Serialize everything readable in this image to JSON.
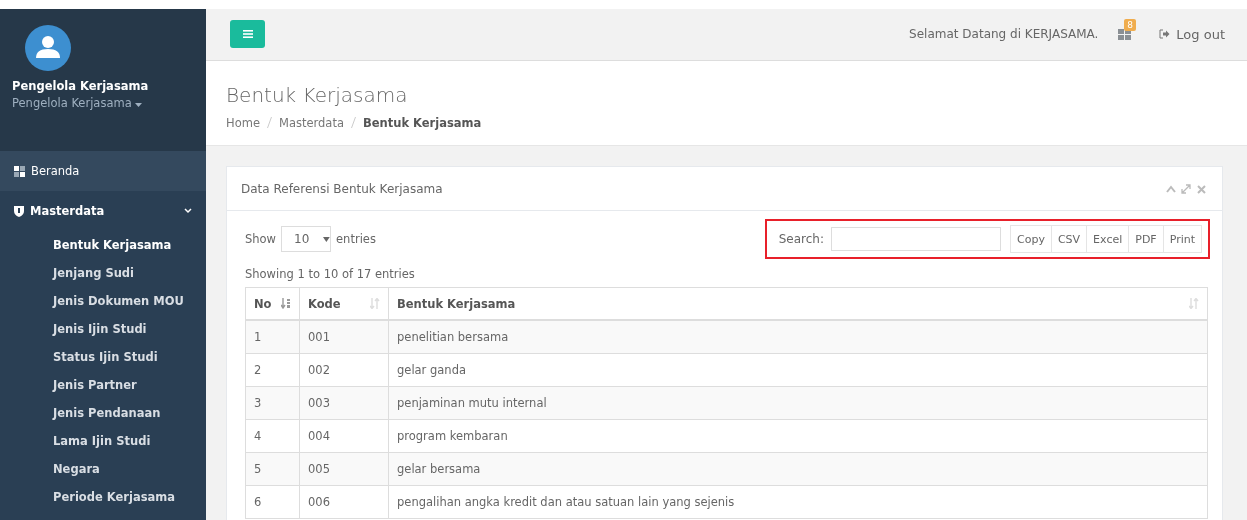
{
  "user": {
    "name": "Pengelola Kerjasama",
    "role": "Pengelola Kerjasama"
  },
  "sidebar": {
    "items": [
      {
        "label": "Beranda",
        "kind": "link"
      },
      {
        "label": "Masterdata",
        "kind": "group",
        "expanded": true,
        "children": [
          {
            "label": "Bentuk Kerjasama",
            "selected": true
          },
          {
            "label": "Jenjang Sudi",
            "selected": false
          },
          {
            "label": "Jenis Dokumen MOU",
            "selected": false
          },
          {
            "label": "Jenis Ijin Studi",
            "selected": false
          },
          {
            "label": "Status Ijin Studi",
            "selected": false
          },
          {
            "label": "Jenis Partner",
            "selected": false
          },
          {
            "label": "Jenis Pendanaan",
            "selected": false
          },
          {
            "label": "Lama Ijin Studi",
            "selected": false
          },
          {
            "label": "Negara",
            "selected": false
          },
          {
            "label": "Periode Kerjasama",
            "selected": false
          }
        ]
      }
    ]
  },
  "topbar": {
    "welcome": "Selamat Datang di KERJASAMA.",
    "badge": "8",
    "logout": "Log out"
  },
  "page": {
    "title": "Bentuk Kerjasama",
    "breadcrumb": [
      {
        "label": "Home",
        "current": false
      },
      {
        "label": "Masterdata",
        "current": false
      },
      {
        "label": "Bentuk Kerjasama",
        "current": true
      }
    ]
  },
  "panel": {
    "title": "Data Referensi Bentuk Kerjasama",
    "length": {
      "before": "Show",
      "value": "10",
      "after": "entries"
    },
    "search": {
      "label": "Search:",
      "highlighted": true
    },
    "buttons": [
      "Copy",
      "CSV",
      "Excel",
      "PDF",
      "Print"
    ],
    "info": "Showing 1 to 10 of 17 entries",
    "table": {
      "columns": [
        {
          "label": "No"
        },
        {
          "label": "Kode"
        },
        {
          "label": "Bentuk Kerjasama"
        }
      ],
      "rows": [
        [
          "1",
          "001",
          "penelitian bersama"
        ],
        [
          "2",
          "002",
          "gelar ganda"
        ],
        [
          "3",
          "003",
          "penjaminan mutu internal"
        ],
        [
          "4",
          "004",
          "program kembaran"
        ],
        [
          "5",
          "005",
          "gelar bersama"
        ],
        [
          "6",
          "006",
          "pengalihan angka kredit dan atau satuan lain yang sejenis"
        ]
      ]
    }
  }
}
